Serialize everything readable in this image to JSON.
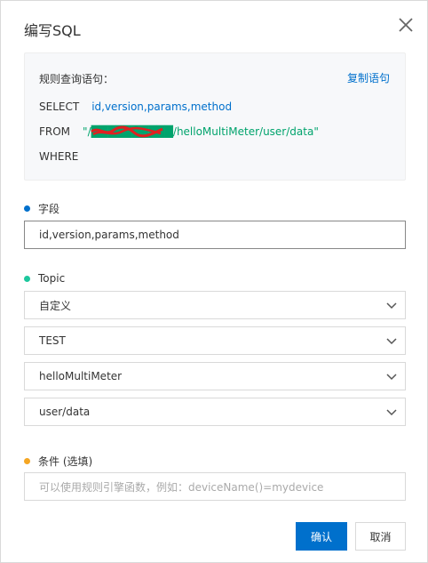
{
  "dialog": {
    "title": "编写SQL",
    "close_icon": "close-icon"
  },
  "sql": {
    "header": "规则查询语句：",
    "copy_label": "复制语句",
    "select_kw": "SELECT",
    "select_val": "id,version,params,method",
    "from_kw": "FROM",
    "from_val": "\"/██████████/helloMultiMeter/user/data\"",
    "where_kw": "WHERE"
  },
  "fields_section": {
    "label": "字段",
    "dot_color": "#0070cc",
    "value": "id,version,params,method"
  },
  "topic_section": {
    "label": "Topic",
    "dot_color": "#1dc79d",
    "selects": [
      {
        "value": "自定义"
      },
      {
        "value": "TEST"
      },
      {
        "value": "helloMultiMeter"
      },
      {
        "value": "user/data"
      }
    ]
  },
  "condition_section": {
    "label": "条件 (选填)",
    "dot_color": "#f5a623",
    "placeholder": "可以使用规则引擎函数，例如：deviceName()=mydevice"
  },
  "buttons": {
    "ok": "确认",
    "cancel": "取消"
  },
  "colors": {
    "accent": "#0070cc",
    "sql_string": "#00a36c",
    "redaction": "#e02020"
  }
}
